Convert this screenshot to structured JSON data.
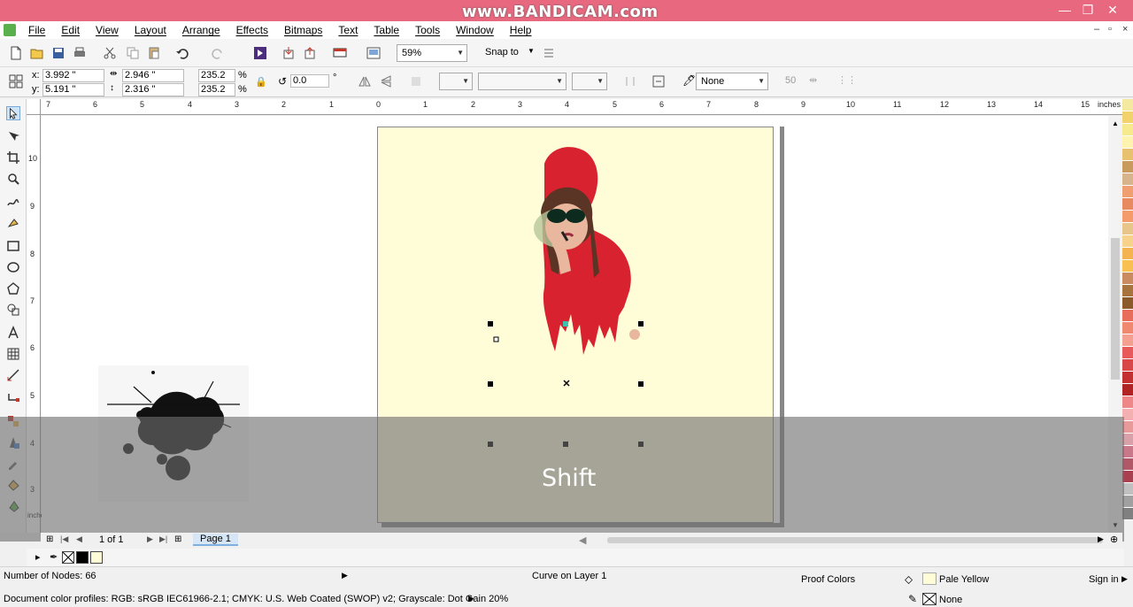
{
  "window": {
    "watermark": "www.BANDICAM.com",
    "controls": [
      "—",
      "❐",
      "✕"
    ]
  },
  "menu": [
    "File",
    "Edit",
    "View",
    "Layout",
    "Arrange",
    "Effects",
    "Bitmaps",
    "Text",
    "Table",
    "Tools",
    "Window",
    "Help"
  ],
  "toolbar": {
    "zoom": "59%",
    "snap_to": "Snap to"
  },
  "properties": {
    "x_label": "x:",
    "x_value": "3.992 \"",
    "y_label": "y:",
    "y_value": "5.191 \"",
    "width_value": "2.946 \"",
    "height_value": "2.316 \"",
    "scale_x": "235.2",
    "scale_y": "235.2",
    "percent": "%",
    "rotation": "0.0",
    "degree": "°",
    "outline": "None",
    "outline_width": "50"
  },
  "rulers": {
    "h_ticks": [
      "7",
      "6",
      "5",
      "4",
      "3",
      "2",
      "1",
      "0",
      "1",
      "2",
      "3",
      "4",
      "5",
      "6",
      "7",
      "8",
      "9",
      "10",
      "11",
      "12",
      "13",
      "14",
      "15"
    ],
    "h_unit": "inches",
    "v_ticks": [
      "10",
      "9",
      "8",
      "7",
      "6",
      "5",
      "4",
      "3"
    ],
    "v_unit": "inches"
  },
  "keystroke_overlay": "Shift",
  "page_nav": {
    "count": "1 of 1",
    "tab": "Page 1"
  },
  "status": {
    "nodes": "Number of Nodes: 66",
    "object": "Curve on Layer 1",
    "proof": "Proof Colors",
    "fill": "Pale Yellow",
    "outline": "None",
    "sign_in": "Sign in",
    "profiles": "Document color profiles: RGB: sRGB IEC61966-2.1; CMYK: U.S. Web Coated (SWOP) v2; Grayscale: Dot Gain 20%"
  },
  "colors": {
    "title": "#e8697f",
    "page_fill": "#fffcd8",
    "palette": [
      "#f5e8a0",
      "#f2d36b",
      "#f7e98e",
      "#fff3b0",
      "#e8c170",
      "#c99a5e",
      "#d7b48c",
      "#f0a070",
      "#e88a60",
      "#f39b6b",
      "#e7c58b",
      "#f6d28a",
      "#f2b350",
      "#f8c050",
      "#c98c60",
      "#a8743e",
      "#8b5a2b",
      "#e76c5a",
      "#f08870",
      "#f4a090",
      "#e85a5a",
      "#d84848",
      "#c23030",
      "#b02424",
      "#ee8888",
      "#f4b0b0",
      "#e89a9a",
      "#d8a0a8",
      "#c87888",
      "#b05868",
      "#a84050",
      "#c0c0c0",
      "#a0a0a0",
      "#808080"
    ]
  }
}
